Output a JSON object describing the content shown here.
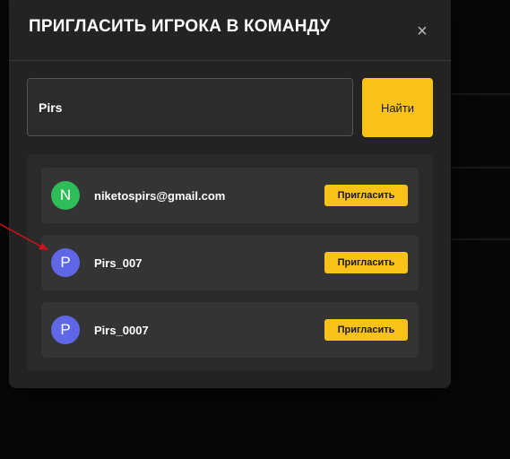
{
  "modal": {
    "title": "ПРИГЛАСИТЬ ИГРОКА В КОМАНДУ",
    "close_icon": "×"
  },
  "search": {
    "value": "Pirs",
    "placeholder": "",
    "button_label": "Найти"
  },
  "results": [
    {
      "avatar_letter": "N",
      "avatar_color": "#2ebd59",
      "name": "niketospirs@gmail.com",
      "invite_label": "Пригласить"
    },
    {
      "avatar_letter": "P",
      "avatar_color": "#5f67e6",
      "name": "Pirs_007",
      "invite_label": "Пригласить"
    },
    {
      "avatar_letter": "P",
      "avatar_color": "#5f67e6",
      "name": "Pirs_0007",
      "invite_label": "Пригласить"
    }
  ],
  "colors": {
    "accent": "#f8c218",
    "modal_bg": "#232323",
    "annotation_arrow": "#d0121b"
  }
}
